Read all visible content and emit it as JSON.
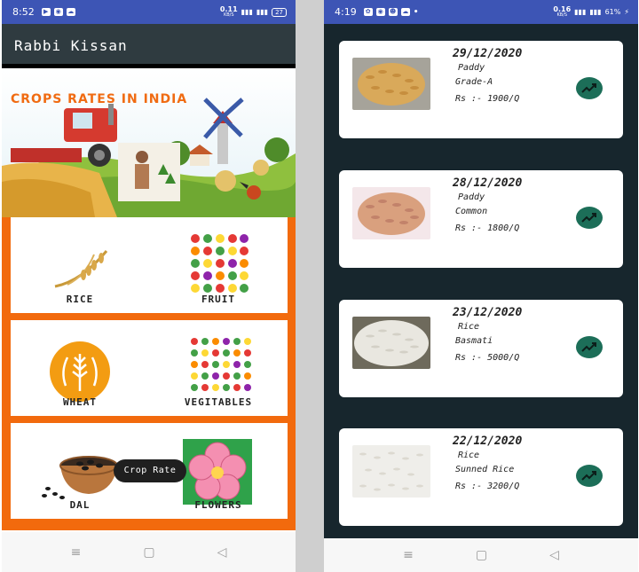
{
  "left_phone": {
    "status": {
      "time": "8:52",
      "net_speed": "0.11",
      "net_unit": "KB/S",
      "battery": "27"
    },
    "app_title": "Rabbi Kissan",
    "banner_title": "CROPS RATES IN INDIA",
    "categories": [
      {
        "label": "RICE",
        "icon": "rice-stalk-icon"
      },
      {
        "label": "FRUIT",
        "icon": "fruit-grid-icon"
      },
      {
        "label": "WHEAT",
        "icon": "wheat-badge-icon"
      },
      {
        "label": "VEGITABLES",
        "icon": "vegetables-grid-icon"
      },
      {
        "label": "DAL",
        "icon": "dal-bowl-icon"
      },
      {
        "label": "FLOWERS",
        "icon": "flower-icon"
      }
    ],
    "tooltip": "Crop Rate",
    "nav": {
      "menu": "≡",
      "home": "▢",
      "back": "◁"
    }
  },
  "right_phone": {
    "status": {
      "time": "4:19",
      "net_speed": "0.16",
      "net_unit": "KB/S",
      "battery": "61%"
    },
    "rates": [
      {
        "date": "29/12/2020",
        "crop": "Paddy",
        "variety": "Grade-A",
        "price": "Rs :- 1900/Q",
        "img": "paddy-grade-a"
      },
      {
        "date": "28/12/2020",
        "crop": "Paddy",
        "variety": "Common",
        "price": "Rs :- 1800/Q",
        "img": "paddy-common"
      },
      {
        "date": "23/12/2020",
        "crop": "Rice",
        "variety": "Basmati",
        "price": "Rs :- 5000/Q",
        "img": "rice-basmati"
      },
      {
        "date": "22/12/2020",
        "crop": "Rice",
        "variety": "Sunned Rice",
        "price": "Rs :- 3200/Q",
        "img": "rice-sunned"
      }
    ],
    "nav": {
      "menu": "≡",
      "home": "▢",
      "back": "◁"
    }
  },
  "colors": {
    "status_bar": "#3d55b5",
    "app_bar": "#2f3b40",
    "grid_bg": "#f26a0d",
    "list_bg": "#17262d",
    "trend_btn": "#1c6e58",
    "banner_title": "#f06b12"
  }
}
